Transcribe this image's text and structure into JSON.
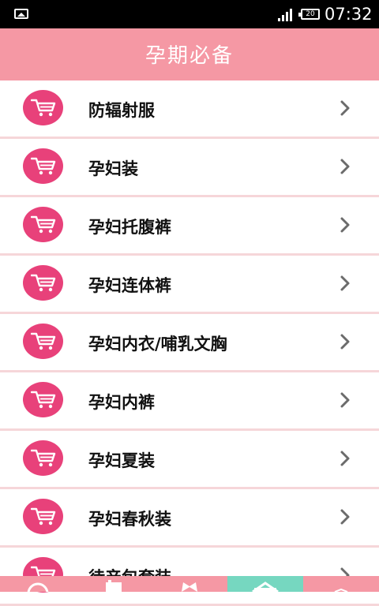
{
  "status_bar": {
    "time": "07:32",
    "battery_label": "20"
  },
  "header": {
    "title": "孕期必备"
  },
  "list": [
    {
      "label": "防辐射服"
    },
    {
      "label": "孕妇装"
    },
    {
      "label": "孕妇托腹裤"
    },
    {
      "label": "孕妇连体裤"
    },
    {
      "label": "孕妇内衣/哺乳文胸"
    },
    {
      "label": "孕妇内裤"
    },
    {
      "label": "孕妇夏装"
    },
    {
      "label": "孕妇春秋装"
    },
    {
      "label": "待产包套装"
    }
  ],
  "icons": {
    "row_icon": "shopping-cart-icon",
    "row_arrow": "chevron-right-icon"
  },
  "colors": {
    "header": "#f598a4",
    "icon": "#e8417a",
    "divider": "#f6d6d9",
    "tab_active": "#76d7c0"
  }
}
